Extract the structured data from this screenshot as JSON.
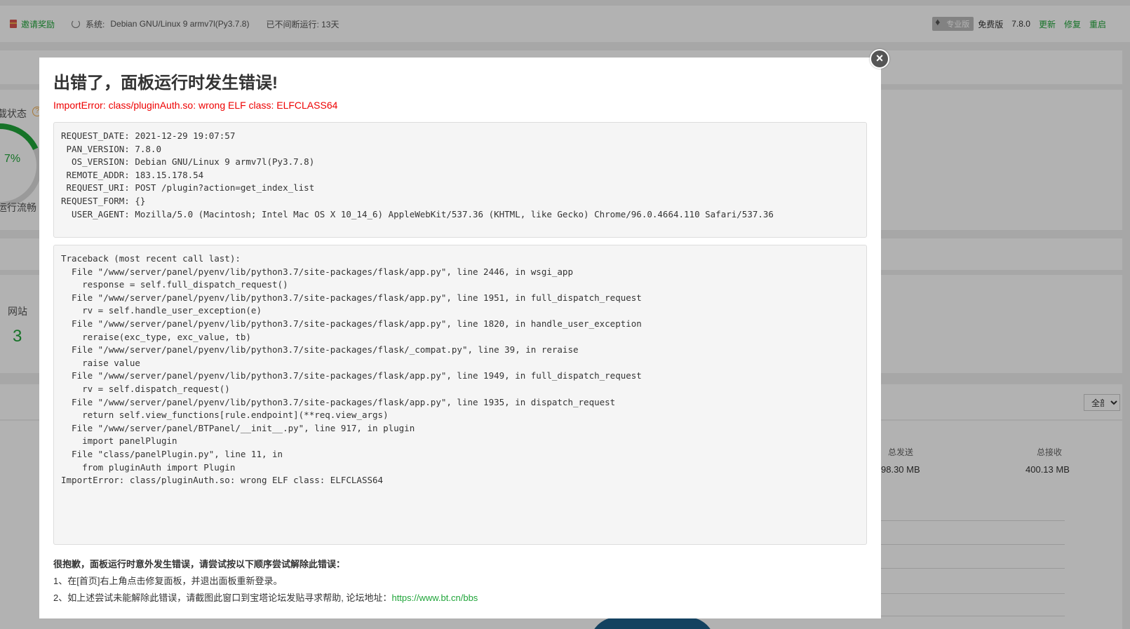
{
  "topbar": {
    "invite_label": "邀请奖励",
    "system_label": "系统:",
    "system_value": "Debian GNU/Linux 9 armv7l(Py3.7.8)",
    "uptime": "已不间断运行: 13天",
    "pro_badge": "专业版",
    "edition": "免费版",
    "version": "7.8.0",
    "update_label": "更新",
    "repair_label": "修复",
    "restart_label": "重启"
  },
  "background": {
    "status_label": "载状态",
    "status_help": "?",
    "load_percent": "7%",
    "load_text": "运行流畅",
    "site_label": "网站",
    "site_count": "3",
    "filter_select": "全部",
    "total_sent_label": "总发送",
    "total_sent_value": "98.30 MB",
    "total_recv_label": "总接收",
    "total_recv_value": "400.13 MB"
  },
  "modal": {
    "title": "出错了，面板运行时发生错误!",
    "error_line": "ImportError: class/pluginAuth.so: wrong ELF class: ELFCLASS64",
    "request_info": "REQUEST_DATE: 2021-12-29 19:07:57\n PAN_VERSION: 7.8.0\n  OS_VERSION: Debian GNU/Linux 9 armv7l(Py3.7.8)\n REMOTE_ADDR: 183.15.178.54\n REQUEST_URI: POST /plugin?action=get_index_list\nREQUEST_FORM: {}\n  USER_AGENT: Mozilla/5.0 (Macintosh; Intel Mac OS X 10_14_6) AppleWebKit/537.36 (KHTML, like Gecko) Chrome/96.0.4664.110 Safari/537.36",
    "traceback": "Traceback (most recent call last):\n  File \"/www/server/panel/pyenv/lib/python3.7/site-packages/flask/app.py\", line 2446, in wsgi_app\n    response = self.full_dispatch_request()\n  File \"/www/server/panel/pyenv/lib/python3.7/site-packages/flask/app.py\", line 1951, in full_dispatch_request\n    rv = self.handle_user_exception(e)\n  File \"/www/server/panel/pyenv/lib/python3.7/site-packages/flask/app.py\", line 1820, in handle_user_exception\n    reraise(exc_type, exc_value, tb)\n  File \"/www/server/panel/pyenv/lib/python3.7/site-packages/flask/_compat.py\", line 39, in reraise\n    raise value\n  File \"/www/server/panel/pyenv/lib/python3.7/site-packages/flask/app.py\", line 1949, in full_dispatch_request\n    rv = self.dispatch_request()\n  File \"/www/server/panel/pyenv/lib/python3.7/site-packages/flask/app.py\", line 1935, in dispatch_request\n    return self.view_functions[rule.endpoint](**req.view_args)\n  File \"/www/server/panel/BTPanel/__init__.py\", line 917, in plugin\n    import panelPlugin\n  File \"class/panelPlugin.py\", line 11, in\n    from pluginAuth import Plugin\nImportError: class/pluginAuth.so: wrong ELF class: ELFCLASS64",
    "tips_title": "很抱歉，面板运行时意外发生错误，请尝试按以下顺序尝试解除此错误：",
    "tip1": "1、在[首页]右上角点击修复面板，并退出面板重新登录。",
    "tip2": "2、如上述尝试未能解除此错误，请截图此窗口到宝塔论坛发贴寻求帮助, 论坛地址：",
    "forum_link": "https://www.bt.cn/bbs",
    "close_symbol": "×"
  }
}
